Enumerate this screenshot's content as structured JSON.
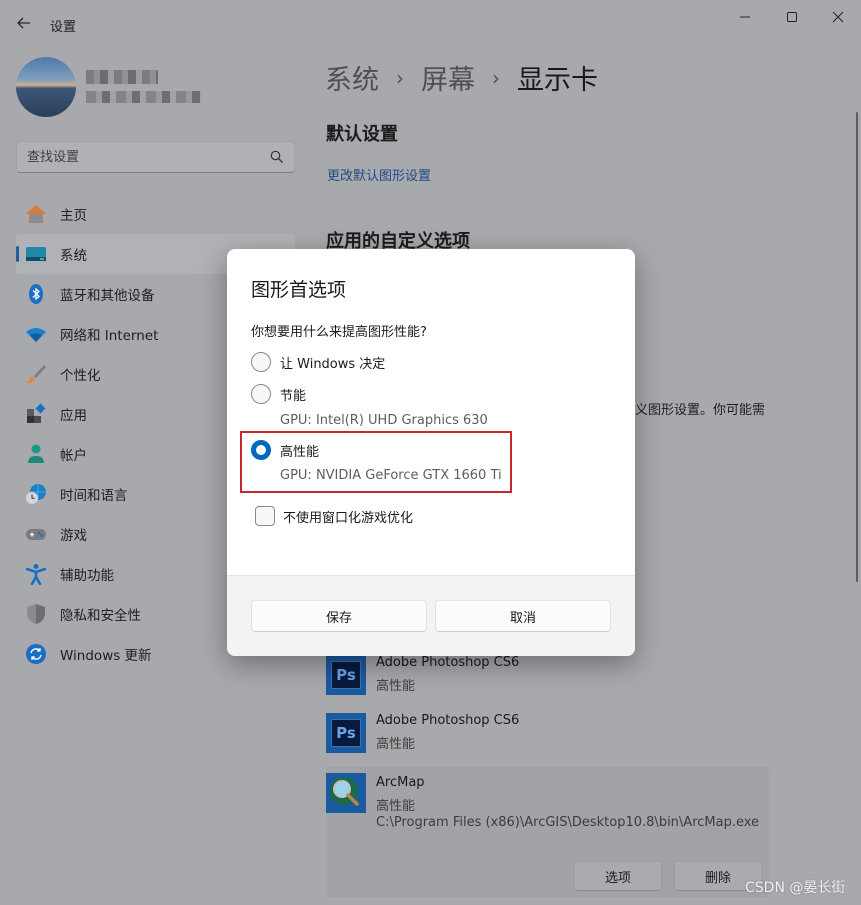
{
  "window": {
    "app_title": "设置",
    "controls": {
      "minimize": "minimize-icon",
      "maximize": "maximize-icon",
      "close": "close-icon"
    }
  },
  "profile": {
    "name": "(pixelated)",
    "email": "(pixelated)"
  },
  "search": {
    "placeholder": "查找设置",
    "value": ""
  },
  "sidebar": {
    "items": [
      {
        "label": "主页",
        "icon": "home-icon",
        "active": false
      },
      {
        "label": "系统",
        "icon": "system-display-icon",
        "active": true
      },
      {
        "label": "蓝牙和其他设备",
        "icon": "bluetooth-icon",
        "active": false
      },
      {
        "label": "网络和 Internet",
        "icon": "wifi-icon",
        "active": false
      },
      {
        "label": "个性化",
        "icon": "brush-icon",
        "active": false
      },
      {
        "label": "应用",
        "icon": "apps-icon",
        "active": false
      },
      {
        "label": "帐户",
        "icon": "account-icon",
        "active": false
      },
      {
        "label": "时间和语言",
        "icon": "time-language-icon",
        "active": false
      },
      {
        "label": "游戏",
        "icon": "gamepad-icon",
        "active": false
      },
      {
        "label": "辅助功能",
        "icon": "accessibility-icon",
        "active": false
      },
      {
        "label": "隐私和安全性",
        "icon": "shield-icon",
        "active": false
      },
      {
        "label": "Windows 更新",
        "icon": "windows-update-icon",
        "active": false
      }
    ]
  },
  "main": {
    "breadcrumb": [
      "系统",
      "屏幕",
      "显示卡"
    ],
    "breadcrumb_separator": "›",
    "default_settings_title": "默认设置",
    "change_default_link": "更改默认图形设置",
    "custom_options_title": "应用的自定义选项",
    "partial_description": "义图形设置。你可能需",
    "apps": [
      {
        "name": "Adobe Photoshop CS6",
        "preference": "高性能",
        "icon": "photoshop-icon",
        "icon_text": "Ps"
      },
      {
        "name": "Adobe Photoshop CS6",
        "preference": "高性能",
        "icon": "photoshop-icon",
        "icon_text": "Ps"
      },
      {
        "name": "ArcMap",
        "preference": "高性能",
        "icon": "arcmap-icon",
        "path": "C:\\Program Files (x86)\\ArcGIS\\Desktop10.8\\bin\\ArcMap.exe",
        "expanded": true,
        "options_label": "选项",
        "remove_label": "删除"
      }
    ]
  },
  "dialog": {
    "title": "图形首选项",
    "question": "你想要用什么来提高图形性能?",
    "options": [
      {
        "label": "让 Windows 决定",
        "sub": "",
        "checked": false
      },
      {
        "label": "节能",
        "sub": "GPU: Intel(R) UHD Graphics 630",
        "checked": false
      },
      {
        "label": "高性能",
        "sub": "GPU: NVIDIA GeForce GTX 1660 Ti",
        "checked": true
      }
    ],
    "checkbox": {
      "label": "不使用窗口化游戏优化",
      "checked": false
    },
    "save_label": "保存",
    "cancel_label": "取消",
    "highlight_color": "#c8272c",
    "accent_color": "#0067c0"
  },
  "watermark": "CSDN @晏长街"
}
